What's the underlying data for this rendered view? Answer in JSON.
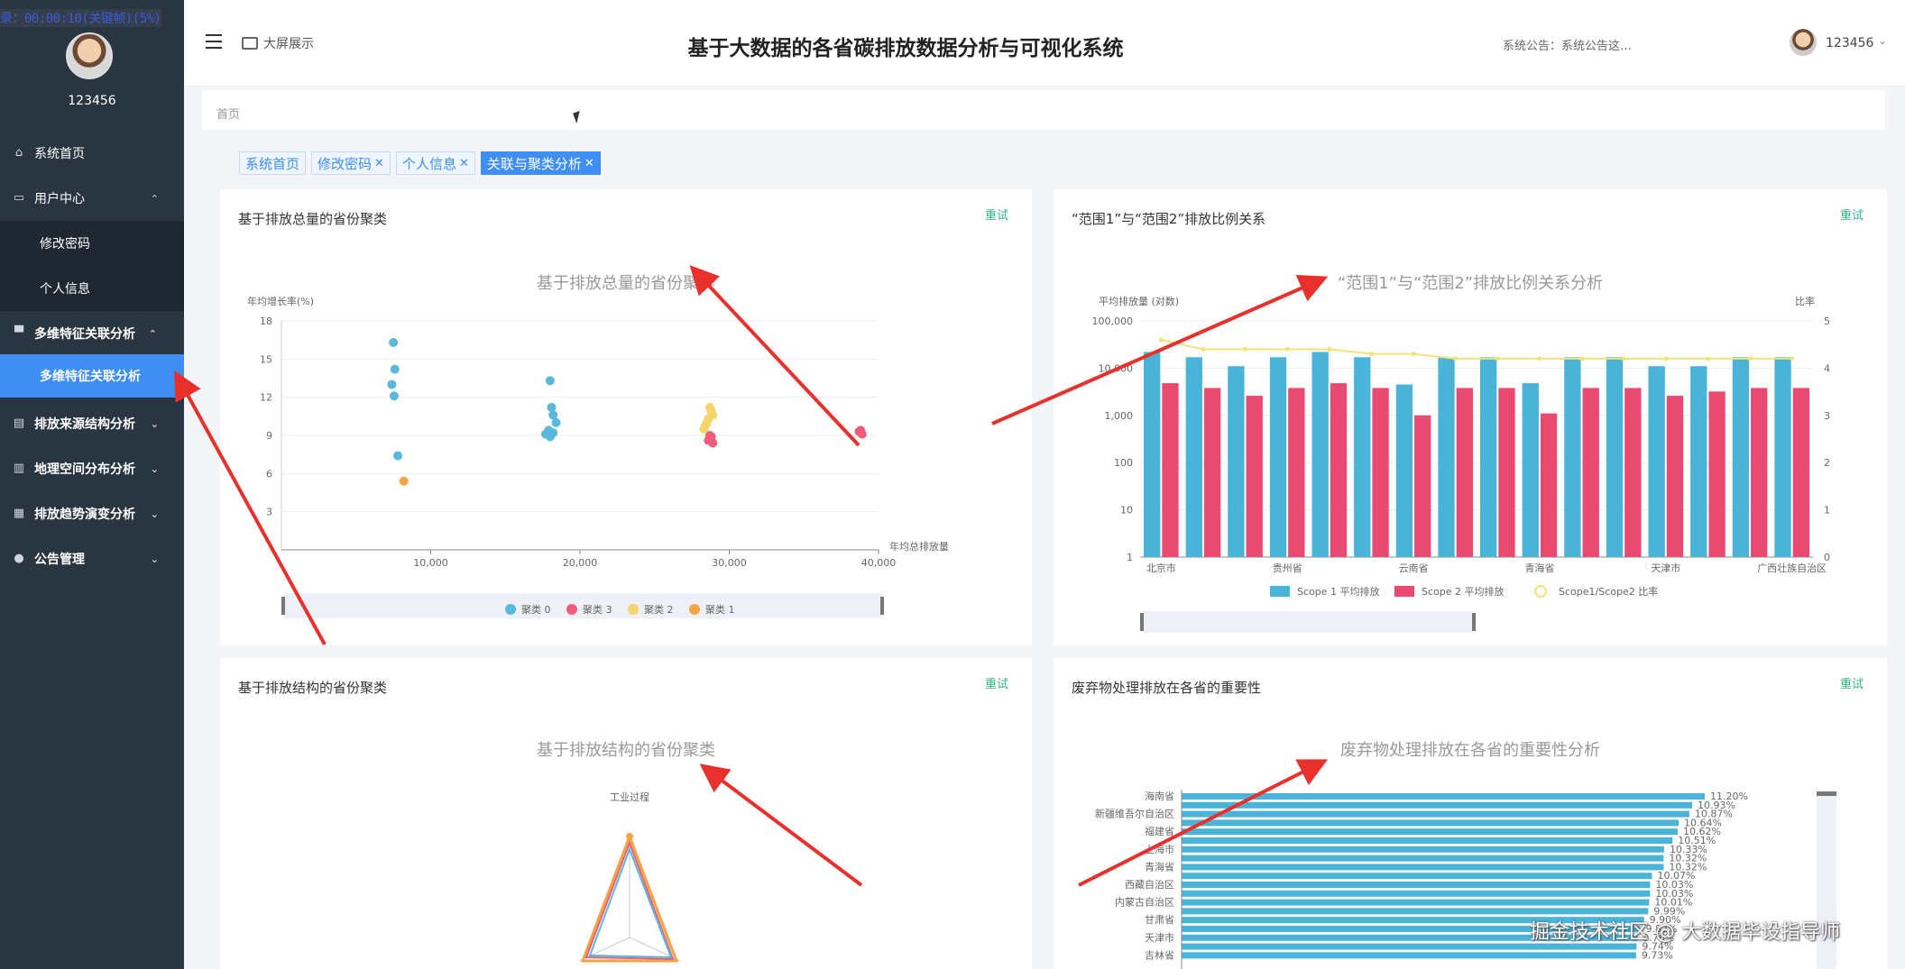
{
  "recording_indicator": "录：00:00:10(关键帧)(5%)",
  "sidebar": {
    "username": "123456",
    "items": [
      {
        "label": "系统首页",
        "icon": "home-icon"
      },
      {
        "label": "用户中心",
        "icon": "user-card-icon"
      },
      {
        "label": "修改密码"
      },
      {
        "label": "个人信息"
      },
      {
        "label": "多维特征关联分析",
        "icon": "monitor-icon"
      },
      {
        "label": "多维特征关联分析"
      },
      {
        "label": "排放来源结构分析",
        "icon": "clipboard-icon"
      },
      {
        "label": "地理空间分布分析",
        "icon": "bar-chart-icon"
      },
      {
        "label": "排放趋势演变分析",
        "icon": "grid-icon"
      },
      {
        "label": "公告管理",
        "icon": "person-icon"
      }
    ]
  },
  "header": {
    "bigscreen_label": "大屏展示",
    "title": "基于大数据的各省碳排放数据分析与可视化系统",
    "notice": "系统公告：系统公告这…",
    "username": "123456"
  },
  "breadcrumb": "首页",
  "tabs": [
    "系统首页",
    "修改密码",
    "个人信息",
    "关联与聚类分析"
  ],
  "panels": {
    "p1": {
      "heading": "基于排放总量的省份聚类",
      "retry": "重试"
    },
    "p2": {
      "heading": "“范围1”与“范围2”排放比例关系",
      "retry": "重试"
    },
    "p3": {
      "heading": "基于排放结构的省份聚类",
      "retry": "重试"
    },
    "p4": {
      "heading": "废弃物处理排放在各省的重要性",
      "retry": "重试"
    }
  },
  "chart_data": [
    {
      "type": "scatter",
      "title": "基于排放总量的省份聚类",
      "xlabel": "年均总排放量",
      "ylabel": "年均增长率(%)",
      "xlim": [
        0,
        40000
      ],
      "ylim": [
        0,
        18
      ],
      "xticks": [
        "10,000",
        "20,000",
        "30,000",
        "40,000"
      ],
      "yticks": [
        "3",
        "6",
        "9",
        "12",
        "15",
        "18"
      ],
      "legend": [
        "聚类 0",
        "聚类 3",
        "聚类 2",
        "聚类 1"
      ],
      "legend_position": "bottom",
      "series": [
        {
          "name": "聚类 0",
          "color": "#5ab8da",
          "points": [
            [
              7500,
              16.3
            ],
            [
              7600,
              14.2
            ],
            [
              7400,
              13.0
            ],
            [
              7550,
              12.1
            ],
            [
              7800,
              7.4
            ],
            [
              18000,
              13.3
            ],
            [
              18100,
              11.2
            ],
            [
              18200,
              10.6
            ],
            [
              18400,
              10.0
            ],
            [
              17900,
              9.4
            ],
            [
              17700,
              9.1
            ],
            [
              18000,
              8.9
            ],
            [
              18200,
              9.2
            ]
          ]
        },
        {
          "name": "聚类 3",
          "color": "#ee5e7b",
          "points": [
            [
              28600,
              8.6
            ],
            [
              28800,
              8.9
            ],
            [
              28700,
              9.0
            ],
            [
              28900,
              8.4
            ],
            [
              38700,
              9.3
            ],
            [
              38900,
              9.1
            ],
            [
              38800,
              9.4
            ]
          ]
        },
        {
          "name": "聚类 2",
          "color": "#f5d56b",
          "points": [
            [
              28400,
              9.8
            ],
            [
              28600,
              10.3
            ],
            [
              28800,
              10.9
            ],
            [
              28700,
              11.2
            ],
            [
              28500,
              10.0
            ],
            [
              28300,
              9.5
            ],
            [
              28900,
              10.6
            ]
          ]
        },
        {
          "name": "聚类 1",
          "color": "#f5a444",
          "points": [
            [
              8200,
              5.4
            ]
          ]
        }
      ]
    },
    {
      "type": "bar",
      "title": "“范围1”与“范围2”排放比例关系分析",
      "ylabel": "平均排放量 (对数)",
      "y2label": "比率",
      "yscale": "log",
      "yticks": [
        "1",
        "10",
        "100",
        "1,000",
        "10,000",
        "100,000"
      ],
      "y2ticks": [
        "0",
        "1",
        "2",
        "3",
        "4",
        "5"
      ],
      "categories": [
        "北京市",
        "",
        "",
        "贵州省",
        "",
        "",
        "云南省",
        "",
        "",
        "青海省",
        "",
        "",
        "天津市",
        "",
        "",
        "广西壮族自治区"
      ],
      "series": [
        {
          "name": "Scope 1 平均排放",
          "color": "#4ab3d8",
          "values": [
            22000,
            17000,
            11000,
            17000,
            22000,
            17000,
            4500,
            17000,
            17000,
            4800,
            17000,
            17000,
            11000,
            11000,
            17000,
            17000
          ]
        },
        {
          "name": "Scope 2 平均排放",
          "color": "#e84a72",
          "values": [
            4800,
            3800,
            2600,
            3800,
            4800,
            3800,
            1000,
            3800,
            3800,
            1100,
            3800,
            3800,
            2600,
            3200,
            3800,
            3800
          ]
        },
        {
          "name": "Scope1/Scope2 比率",
          "color": "#f5e17a",
          "values": [
            4.6,
            4.4,
            4.4,
            4.4,
            4.4,
            4.3,
            4.3,
            4.2,
            4.2,
            4.2,
            4.2,
            4.2,
            4.2,
            4.2,
            4.2,
            4.2
          ]
        }
      ],
      "legend_position": "bottom"
    },
    {
      "type": "radar",
      "title": "基于排放结构的省份聚类",
      "indicators": [
        "工业过程"
      ]
    },
    {
      "type": "bar",
      "orientation": "horizontal",
      "title": "废弃物处理排放在各省的重要性分析",
      "categories": [
        "海南省",
        "",
        "新疆维吾尔自治区",
        "",
        "福建省",
        "",
        "上海市",
        "",
        "青海省",
        "",
        "西藏自治区",
        "",
        "内蒙古自治区",
        "",
        "甘肃省",
        "",
        "天津市",
        "",
        "吉林省"
      ],
      "values": [
        11.2,
        10.93,
        10.87,
        10.64,
        10.62,
        10.51,
        10.33,
        10.32,
        10.32,
        10.07,
        10.03,
        10.03,
        10.01,
        9.99,
        9.9,
        9.82,
        9.76,
        9.74,
        9.73
      ],
      "value_labels": [
        "11.20%",
        "10.93%",
        "10.87%",
        "10.64%",
        "10.62%",
        "10.51%",
        "10.33%",
        "10.32%",
        "10.32%",
        "10.07%",
        "10.03%",
        "10.03%",
        "10.01%",
        "9.99%",
        "9.90%",
        "9.82%",
        "9.76%",
        "9.74%",
        "9.73%"
      ],
      "color": "#4ab3d8"
    }
  ],
  "watermark": "掘金技术社区 @ 大数据毕设指导师"
}
